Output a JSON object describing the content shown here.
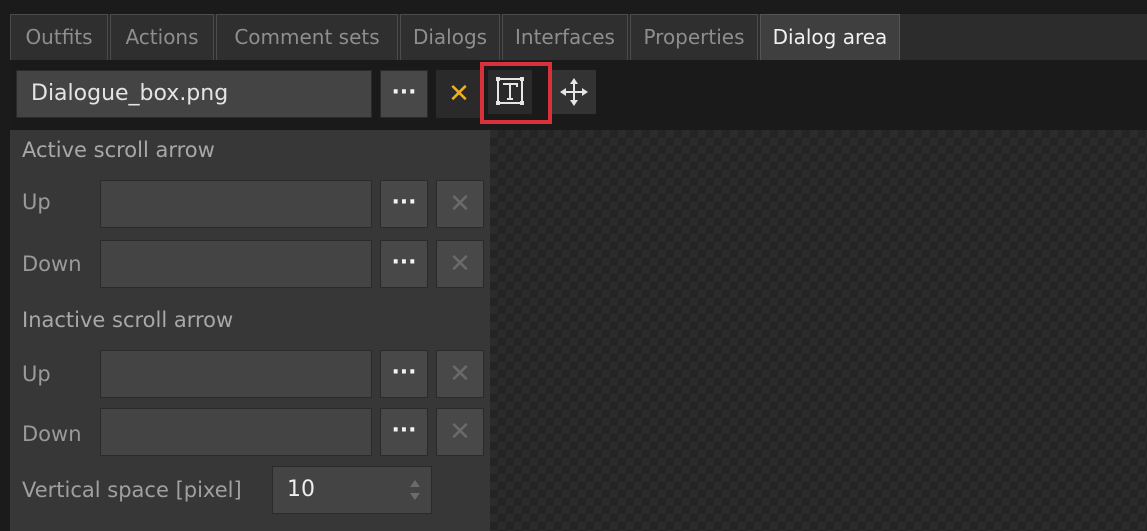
{
  "tabs": [
    {
      "label": "Outfits"
    },
    {
      "label": "Actions"
    },
    {
      "label": "Comment sets"
    },
    {
      "label": "Dialogs"
    },
    {
      "label": "Interfaces"
    },
    {
      "label": "Properties"
    },
    {
      "label": "Dialog area"
    }
  ],
  "image_field": {
    "value": "Dialogue_box.png",
    "browse_label": "···",
    "clear_label": "✕"
  },
  "tools": {
    "text_area_icon": "text-box-icon",
    "move_icon": "move-arrows-icon"
  },
  "active_scroll_arrow": {
    "title": "Active scroll arrow",
    "up_label": "Up",
    "down_label": "Down",
    "up_value": "",
    "down_value": ""
  },
  "inactive_scroll_arrow": {
    "title": "Inactive scroll arrow",
    "up_label": "Up",
    "down_label": "Down",
    "up_value": "",
    "down_value": ""
  },
  "browse_label": "···",
  "clear_label": "✕",
  "vertical_space": {
    "label": "Vertical space [pixel]",
    "value": "10"
  },
  "colors": {
    "highlight": "#d9313a",
    "clear_active": "#f1b11a"
  }
}
